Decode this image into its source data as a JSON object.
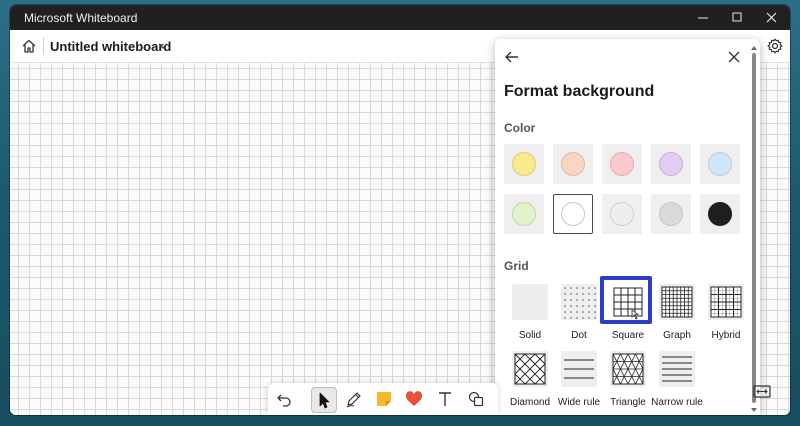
{
  "window": {
    "title": "Microsoft Whiteboard"
  },
  "topbar": {
    "whiteboard_title": "Untitled whiteboard"
  },
  "panel": {
    "title": "Format background",
    "color_label": "Color",
    "grid_label": "Grid",
    "colors": [
      {
        "name": "yellow",
        "hex": "#fbe98e"
      },
      {
        "name": "peach",
        "hex": "#fbd5c2"
      },
      {
        "name": "pink",
        "hex": "#fbc8cc"
      },
      {
        "name": "lavender",
        "hex": "#e3ccf2"
      },
      {
        "name": "light-blue",
        "hex": "#cfe8f7"
      },
      {
        "name": "light-green",
        "hex": "#e1f2cd"
      },
      {
        "name": "white",
        "hex": "#ffffff"
      },
      {
        "name": "light-gray",
        "hex": "#eeeeee"
      },
      {
        "name": "gray",
        "hex": "#dadada"
      },
      {
        "name": "black",
        "hex": "#1e1e1e"
      }
    ],
    "selected_color": "white",
    "grids": [
      {
        "label": "Solid",
        "icon": "solid-grid-icon"
      },
      {
        "label": "Dot",
        "icon": "dot-grid-icon"
      },
      {
        "label": "Square",
        "icon": "square-grid-icon"
      },
      {
        "label": "Graph",
        "icon": "graph-grid-icon"
      },
      {
        "label": "Hybrid",
        "icon": "hybrid-grid-icon"
      },
      {
        "label": "Diamond",
        "icon": "diamond-grid-icon"
      },
      {
        "label": "Wide rule",
        "icon": "wide-rule-grid-icon"
      },
      {
        "label": "Triangle",
        "icon": "triangle-grid-icon"
      },
      {
        "label": "Narrow rule",
        "icon": "narrow-rule-grid-icon"
      }
    ],
    "selected_grid": "Square"
  },
  "colors": {
    "selection_border": "#2c3dc8",
    "title_bar": "#202020",
    "sticky_note": "#f7b731",
    "heart": "#e8503a"
  },
  "toolbar": {
    "tools": [
      "undo-icon",
      "select-arrow-icon",
      "pen-icon",
      "sticky-note-icon",
      "reaction-heart-icon",
      "text-icon",
      "shapes-icon"
    ],
    "active_tool": "select-arrow-icon"
  }
}
